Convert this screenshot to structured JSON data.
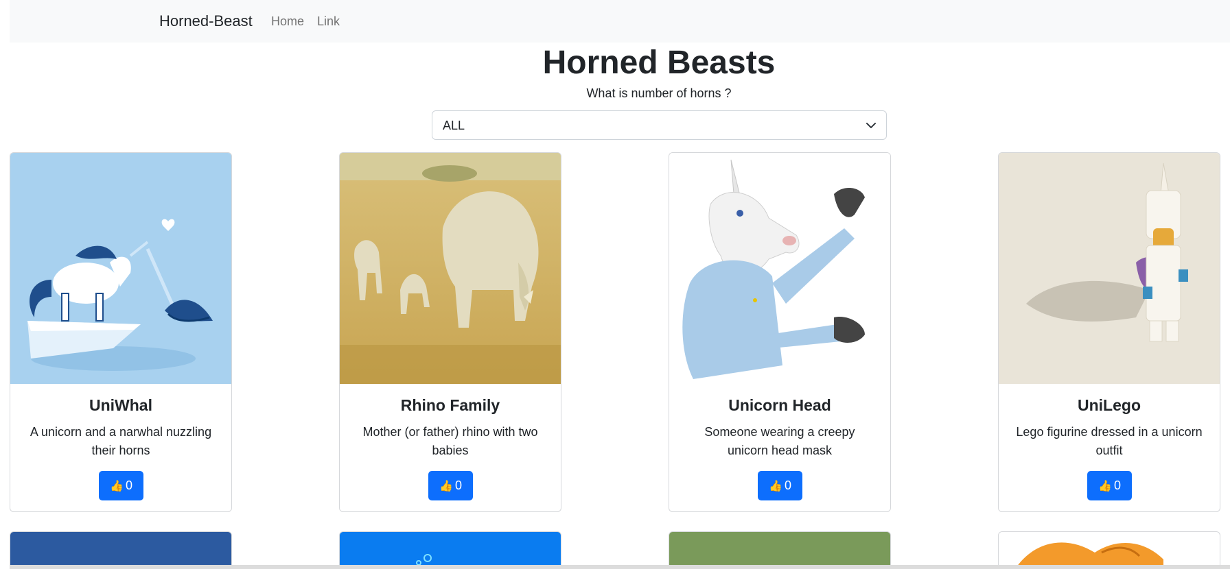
{
  "navbar": {
    "brand": "Horned-Beast",
    "links": [
      {
        "label": "Home"
      },
      {
        "label": "Link"
      }
    ]
  },
  "header": {
    "title": "Horned Beasts",
    "question": "What is number of horns ?"
  },
  "filter": {
    "selected": "ALL"
  },
  "cards": [
    {
      "title": "UniWhal",
      "description": "A unicorn and a narwhal nuzzling their horns",
      "votes": "0"
    },
    {
      "title": "Rhino Family",
      "description": "Mother (or father) rhino with two babies",
      "votes": "0"
    },
    {
      "title": "Unicorn Head",
      "description": "Someone wearing a creepy unicorn head mask",
      "votes": "0"
    },
    {
      "title": "UniLego",
      "description": "Lego figurine dressed in a unicorn outfit",
      "votes": "0"
    }
  ],
  "icons": {
    "vote": "thumbs-up-icon",
    "select": "chevron-down-icon"
  },
  "colors": {
    "primary": "#0d6efd",
    "navbar_bg": "#f8f9fa"
  }
}
